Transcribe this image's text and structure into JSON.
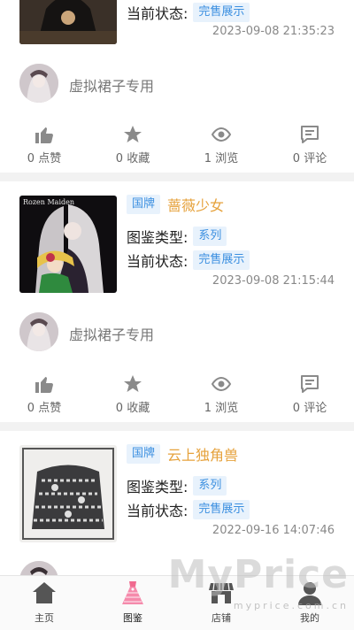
{
  "items": [
    {
      "status_label": "当前状态:",
      "status_value": "完售展示",
      "time": "2023-09-08 21:35:23",
      "user": "虚拟裙子专用",
      "likes": "0 点赞",
      "favs": "0 收藏",
      "views": "1 浏览",
      "comments": "0 评论"
    },
    {
      "tag": "国牌",
      "brand": "蔷薇少女",
      "type_label": "图鉴类型:",
      "type_value": "系列",
      "status_label": "当前状态:",
      "status_value": "完售展示",
      "time": "2023-09-08 21:15:44",
      "user": "虚拟裙子专用",
      "likes": "0 点赞",
      "favs": "0 收藏",
      "views": "1 浏览",
      "comments": "0 评论",
      "thumb_text": "Rozen Maiden"
    },
    {
      "tag": "国牌",
      "brand": "云上独角兽",
      "type_label": "图鉴类型:",
      "type_value": "系列",
      "status_label": "当前状态:",
      "status_value": "完售展示",
      "time": "2022-09-16 14:07:46"
    }
  ],
  "tabbar": {
    "home": "主页",
    "catalog": "图鉴",
    "shop": "店铺",
    "mine": "我的"
  },
  "watermark": {
    "main": "MyPrice",
    "sub": "myprice.com.cn"
  },
  "colors": {
    "brand": "#e6a23c",
    "tag_text": "#3b8fe0",
    "tag_bg": "#e8f2fc"
  }
}
